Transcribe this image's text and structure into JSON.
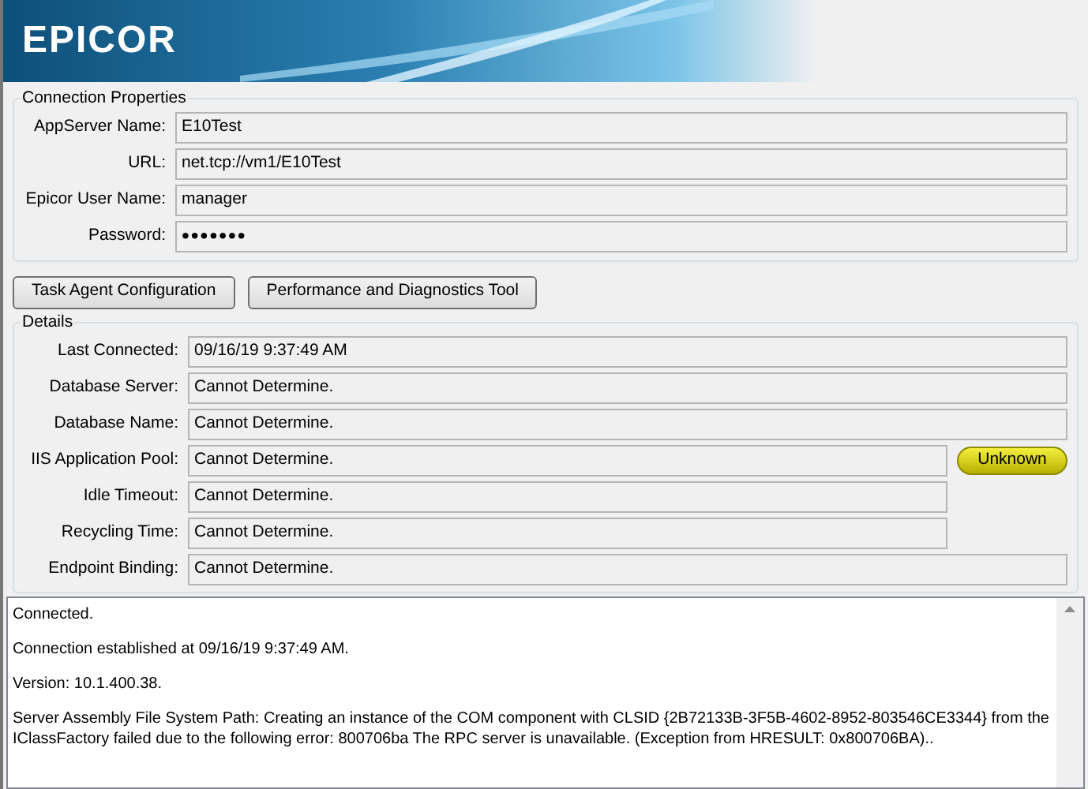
{
  "header": {
    "logo": "EPICOR"
  },
  "connection": {
    "title": "Connection Properties",
    "fields": [
      {
        "label": "AppServer Name:",
        "value": "E10Test",
        "kind": "text"
      },
      {
        "label": "URL:",
        "value": "net.tcp://vm1/E10Test",
        "kind": "text"
      },
      {
        "label": "Epicor User Name:",
        "value": "manager",
        "kind": "text"
      },
      {
        "label": "Password:",
        "value": "•••••••",
        "kind": "password"
      }
    ]
  },
  "buttons": [
    "Task Agent Configuration",
    "Performance and Diagnostics Tool"
  ],
  "details": {
    "title": "Details",
    "rows": [
      {
        "label": "Last Connected:",
        "value": "09/16/19 9:37:49 AM",
        "kind": "full"
      },
      {
        "label": "Database Server:",
        "value": "Cannot Determine.",
        "kind": "full"
      },
      {
        "label": "Database Name:",
        "value": "Cannot Determine.",
        "kind": "full"
      },
      {
        "label": "IIS Application Pool:",
        "value": "Cannot Determine.",
        "kind": "pool",
        "status": {
          "label": "Unknown",
          "kind": "unknown"
        }
      },
      {
        "label": "Idle Timeout:",
        "value": "Cannot Determine.",
        "kind": "pool"
      },
      {
        "label": "Recycling Time:",
        "value": "Cannot Determine.",
        "kind": "pool"
      },
      {
        "label": "Endpoint Binding:",
        "value": "Cannot Determine.",
        "kind": "full"
      }
    ]
  },
  "log": [
    "Connected.",
    "Connection established at 09/16/19 9:37:49 AM.",
    "Version: 10.1.400.38.",
    "Server Assembly File System Path: Creating an instance of the COM component with CLSID {2B72133B-3F5B-4602-8952-803546CE3344} from the IClassFactory failed due to the following error: 800706ba The RPC server is unavailable. (Exception from HRESULT: 0x800706BA).."
  ]
}
